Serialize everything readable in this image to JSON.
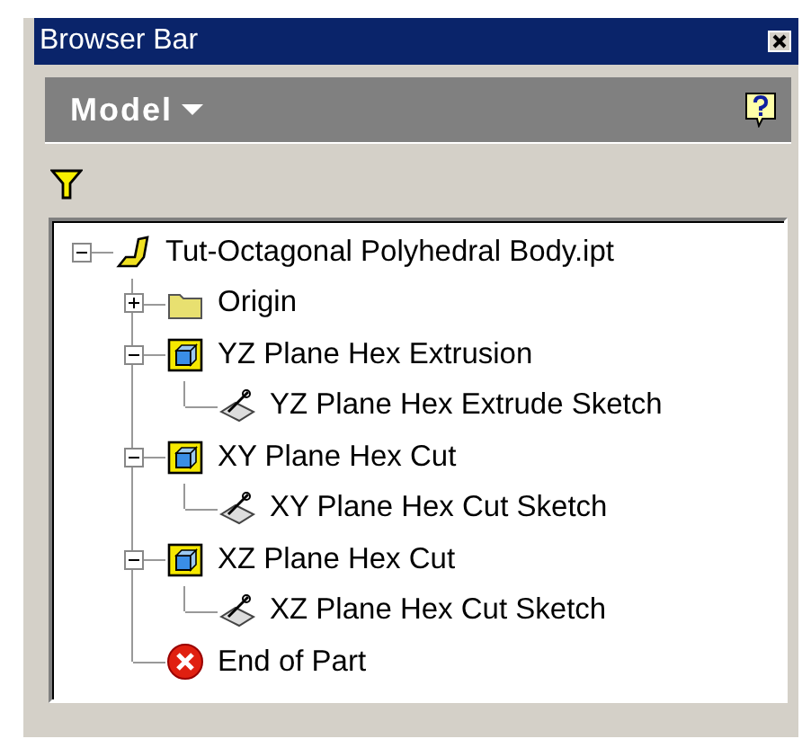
{
  "window": {
    "title": "Browser Bar"
  },
  "header": {
    "title": "Model"
  },
  "tree": [
    {
      "label": "Tut-Octagonal Polyhedral Body.ipt",
      "kind": "part",
      "expanded": true,
      "children": [
        {
          "label": "Origin",
          "kind": "folder",
          "expanded": false
        },
        {
          "label": "YZ Plane Hex Extrusion",
          "kind": "feature",
          "expanded": true,
          "children": [
            {
              "label": "YZ Plane Hex Extrude Sketch",
              "kind": "sketch"
            }
          ]
        },
        {
          "label": "XY Plane Hex Cut",
          "kind": "feature",
          "expanded": true,
          "children": [
            {
              "label": "XY Plane Hex Cut Sketch",
              "kind": "sketch"
            }
          ]
        },
        {
          "label": "XZ Plane Hex Cut",
          "kind": "feature",
          "expanded": true,
          "children": [
            {
              "label": "XZ Plane Hex Cut Sketch",
              "kind": "sketch"
            }
          ]
        },
        {
          "label": "End of Part",
          "kind": "end"
        }
      ]
    }
  ]
}
